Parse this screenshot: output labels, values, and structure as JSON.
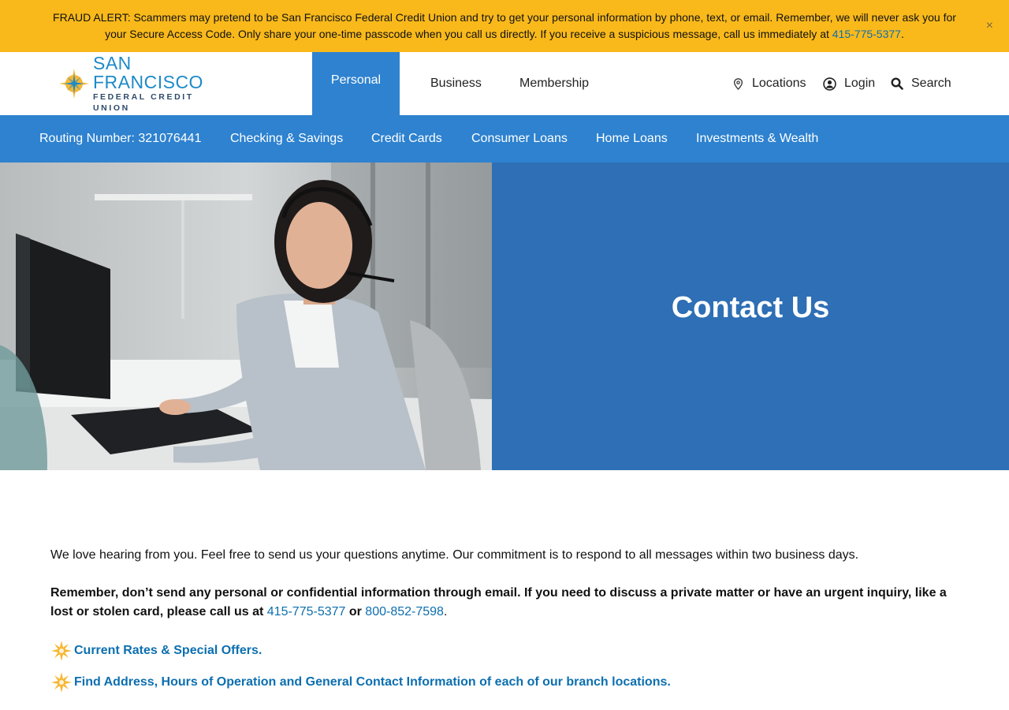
{
  "alert": {
    "text_before": "FRAUD ALERT: Scammers may pretend to be San Francisco Federal Credit Union and try to get your personal information by phone, text, or email. Remember, we will never ask you for your Secure Access Code. Only share your one-time passcode when you call us directly. If you receive a suspicious message, call us immediately at ",
    "phone": "415-775-5377",
    "text_after": ".",
    "close_glyph": "×"
  },
  "logo": {
    "line1": "SAN FRANCISCO",
    "line2": "FEDERAL CREDIT UNION",
    "icon": "sfcu-star-logo-icon"
  },
  "header": {
    "tabs": [
      {
        "label": "Personal",
        "active": true
      },
      {
        "label": "Business"
      },
      {
        "label": "Membership"
      }
    ],
    "utilities": [
      {
        "label": "Locations",
        "icon": "map-pin-icon"
      },
      {
        "label": "Login",
        "icon": "user-circle-icon"
      },
      {
        "label": "Search",
        "icon": "search-icon"
      }
    ]
  },
  "subnav": {
    "routing": "Routing Number: 321076441",
    "items": [
      {
        "label": "Checking & Savings"
      },
      {
        "label": "Credit Cards"
      },
      {
        "label": "Consumer Loans"
      },
      {
        "label": "Home Loans"
      },
      {
        "label": "Investments & Wealth"
      }
    ]
  },
  "hero": {
    "title": "Contact Us"
  },
  "content": {
    "intro": "We love hearing from you. Feel free to send us your questions anytime. Our commitment is to respond to all messages within two business days.",
    "warning_text": "Remember, don’t send any personal or confidential information through email. If you need to discuss a private matter or have an urgent inquiry, like a lost or stolen card, please call us at ",
    "phone1": "415-775-5377",
    "or_text": " or ",
    "phone2": "800-852-7598",
    "period": ".",
    "links": [
      {
        "label": "Current Rates & Special Offers.",
        "icon": "star-bullet-icon"
      },
      {
        "label": "Find Address, Hours of Operation and General Contact Information of each of our branch locations.",
        "icon": "star-bullet-icon"
      }
    ]
  },
  "colors": {
    "alert_bg": "#f9b91b",
    "nav_blue": "#2e82cf",
    "hero_blue": "#2e6fb5",
    "link_blue": "#0c6fb0",
    "logo_blue": "#1d8ac8",
    "star_gold": "#f7b733"
  }
}
